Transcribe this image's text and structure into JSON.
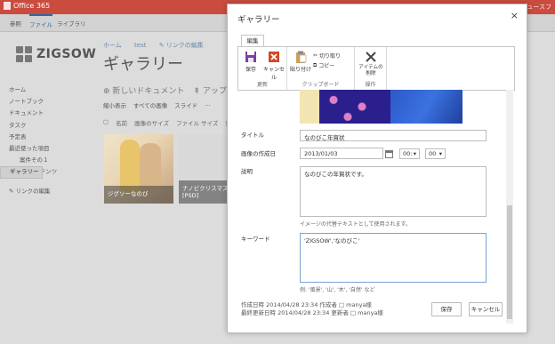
{
  "suite": {
    "brand": "Office 365",
    "right": "ニュースフ"
  },
  "ribbonbar": {
    "tabs": [
      "参照",
      "ファイル",
      "ライブラリ"
    ]
  },
  "site": {
    "logo": "ZIGSOW",
    "breadcrumbs": [
      "ホーム",
      "test",
      "リンクの編集"
    ],
    "title": "ギャラリー"
  },
  "actions": {
    "new_doc": "新しいドキュメント",
    "upload": "アップロー"
  },
  "views": [
    "縮小表示",
    "すべての画像",
    "スライド",
    "..."
  ],
  "columns": [
    "名前",
    "画像のサイズ",
    "ファイル サイズ",
    "更新"
  ],
  "leftnav": [
    {
      "label": "ホーム"
    },
    {
      "label": "ノートブック"
    },
    {
      "label": "ドキュメント"
    },
    {
      "label": "タスク"
    },
    {
      "label": "予定表"
    },
    {
      "label": "最近使った項目"
    },
    {
      "label": "案件その１",
      "sub": true
    },
    {
      "label": "ギャラリー",
      "selected": true
    },
    {
      "label": "サイト コンテンツ"
    },
    {
      "label": "リンクの編集"
    }
  ],
  "thumbs": [
    {
      "caption": "ジグソーなのび"
    },
    {
      "caption": "ナノビクリスマス\n[PSD]"
    }
  ],
  "dialog": {
    "title": "ギャラリー",
    "close": "×",
    "ribbon_tab": "編集",
    "groups": {
      "update": {
        "label": "更新",
        "save": "保存",
        "cancel": "キャンセル"
      },
      "clipboard": {
        "label": "クリップボード",
        "paste": "貼り付け",
        "cut": "切り取り",
        "copy": "コピー"
      },
      "actions": {
        "label": "操作",
        "delete": "アイテムの削除"
      }
    },
    "fields": {
      "title_label": "タイトル",
      "title_value": "なのびこ年賀状",
      "date_label": "画像の作成日",
      "date_value": "2013/01/03",
      "hour": "00:",
      "minute": "00",
      "desc_label": "説明",
      "desc_value": "なのびこの年賀状です。",
      "desc_hint": "イメージの代替テキストとして使用されます。",
      "keyword_label": "キーワード",
      "keyword_value": "'ZIGSOW','なのびこ'",
      "keyword_hint": "例: '風景', '山', '木', '自然' など"
    },
    "meta": {
      "created": "作成日時 2014/04/28 23:34  作成者 □ manya様",
      "modified": "最終更新日時 2014/04/28 23:34  更新者 □ manya様"
    },
    "buttons": {
      "save": "保存",
      "cancel": "キャンセル"
    }
  },
  "colors": {
    "suite": "#c94c3f",
    "accent": "#2a6aa8"
  }
}
